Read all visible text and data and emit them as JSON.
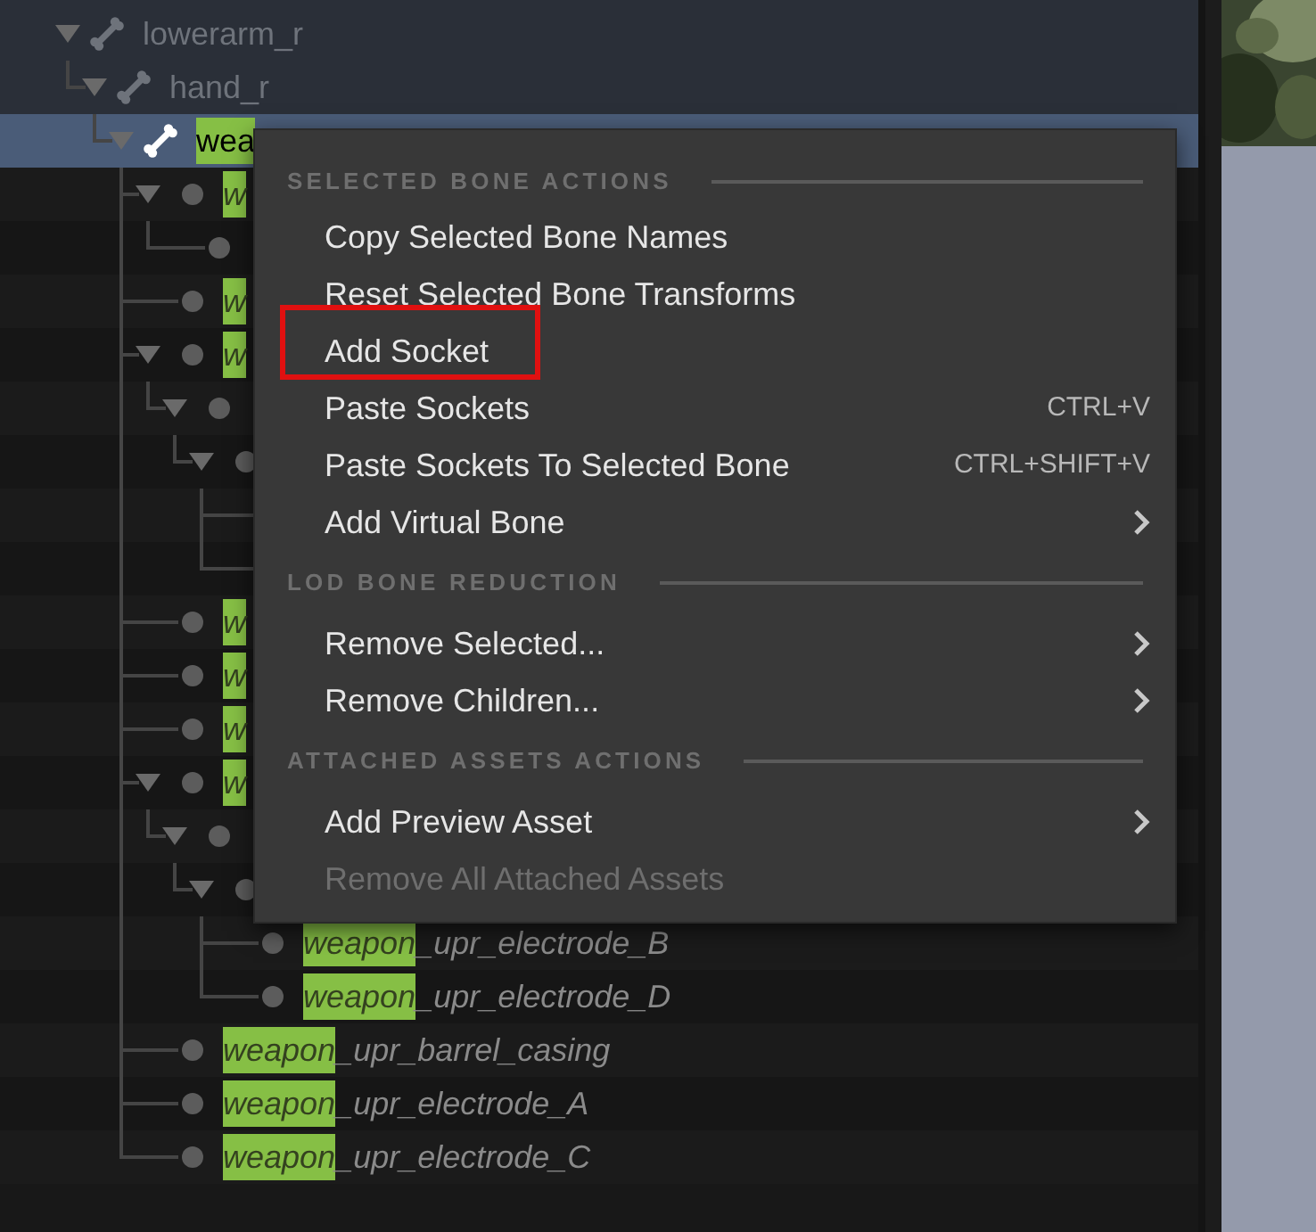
{
  "tree": [
    {
      "kind": "bone",
      "name": "lowerarm_r",
      "expanded": true,
      "selected": false,
      "children": [
        {
          "kind": "bone",
          "name": "hand_r",
          "expanded": true,
          "selected": false,
          "children": [
            {
              "kind": "bone",
              "match": "wea",
              "expanded": true,
              "selected": true,
              "children": [
                {
                  "kind": "socket",
                  "match": "w",
                  "expanded": true,
                  "selected": false,
                  "children": [
                    {
                      "kind": "socket",
                      "selected": false
                    }
                  ]
                },
                {
                  "kind": "socket",
                  "match": "w",
                  "selected": false
                },
                {
                  "kind": "socket",
                  "match": "w",
                  "expanded": true,
                  "selected": false,
                  "children": [
                    {
                      "kind": "socket",
                      "expanded": true,
                      "selected": false,
                      "children": [
                        {
                          "kind": "socket",
                          "expanded": true,
                          "selected": false,
                          "children": [
                            {
                              "selected": false
                            },
                            {
                              "selected": false
                            }
                          ]
                        }
                      ]
                    }
                  ]
                },
                {
                  "kind": "socket",
                  "match": "w",
                  "selected": false
                },
                {
                  "kind": "socket",
                  "match": "w",
                  "selected": false
                },
                {
                  "kind": "socket",
                  "match": "w",
                  "selected": false
                },
                {
                  "kind": "socket",
                  "match": "w",
                  "expanded": true,
                  "selected": false,
                  "children": [
                    {
                      "kind": "socket",
                      "expanded": true,
                      "selected": false,
                      "children": [
                        {
                          "kind": "socket",
                          "expanded": true,
                          "selected": false,
                          "children": [
                            {
                              "kind": "socket",
                              "match": "weapon",
                              "rest": "_upr_electrode_B",
                              "selected": false
                            },
                            {
                              "kind": "socket",
                              "match": "weapon",
                              "rest": "_upr_electrode_D",
                              "selected": false
                            }
                          ]
                        }
                      ]
                    }
                  ]
                },
                {
                  "kind": "socket",
                  "match": "weapon",
                  "rest": "_upr_barrel_casing",
                  "selected": false
                },
                {
                  "kind": "socket",
                  "match": "weapon",
                  "rest": "_upr_electrode_A",
                  "selected": false
                },
                {
                  "kind": "socket",
                  "match": "weapon",
                  "rest": "_upr_electrode_C",
                  "selected": false
                }
              ]
            }
          ]
        }
      ]
    }
  ],
  "context_menu": {
    "sections": [
      {
        "header": "SELECTED BONE ACTIONS",
        "items": [
          {
            "label": "Copy Selected Bone Names",
            "submenu": false,
            "disabled": false,
            "outlined": false
          },
          {
            "label": "Reset Selected Bone Transforms",
            "submenu": false,
            "disabled": false,
            "outlined": false
          },
          {
            "label": "Add Socket",
            "submenu": false,
            "disabled": false,
            "outlined": true
          },
          {
            "label": "Paste Sockets",
            "shortcut": "CTRL+V",
            "submenu": false,
            "disabled": false,
            "outlined": false
          },
          {
            "label": "Paste Sockets To Selected Bone",
            "shortcut": "CTRL+SHIFT+V",
            "submenu": false,
            "disabled": false,
            "outlined": false
          },
          {
            "label": "Add Virtual Bone",
            "submenu": true,
            "disabled": false,
            "outlined": false
          }
        ]
      },
      {
        "header": "LOD BONE REDUCTION",
        "items": [
          {
            "label": "Remove Selected...",
            "submenu": true,
            "disabled": false,
            "outlined": false
          },
          {
            "label": "Remove Children...",
            "submenu": true,
            "disabled": false,
            "outlined": false
          }
        ]
      },
      {
        "header": "ATTACHED ASSETS ACTIONS",
        "items": [
          {
            "label": "Add Preview Asset",
            "submenu": true,
            "disabled": false,
            "outlined": false
          },
          {
            "label": "Remove All Attached Assets",
            "submenu": false,
            "disabled": true,
            "outlined": false
          }
        ]
      }
    ]
  }
}
